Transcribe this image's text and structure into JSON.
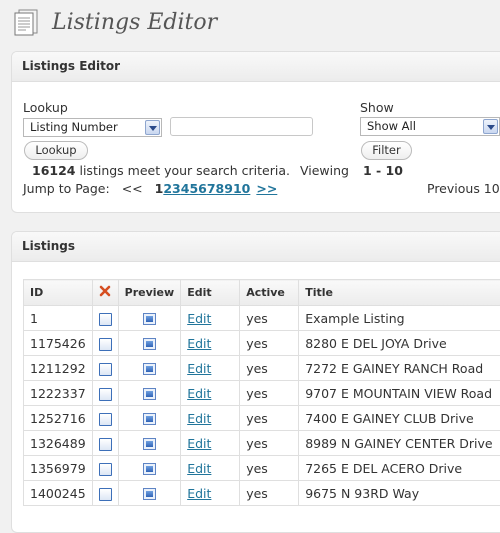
{
  "page": {
    "title": "Listings Editor",
    "icon": "document-icon"
  },
  "filter_box": {
    "heading": "Listings Editor",
    "lookup": {
      "label": "Lookup",
      "select_value": "Listing Number",
      "input_value": "",
      "button_label": "Lookup"
    },
    "show": {
      "label": "Show",
      "select_value": "Show All",
      "button_label": "Filter"
    },
    "results": {
      "count": "16124",
      "text": "listings meet your search criteria.",
      "viewing_label": "Viewing",
      "viewing_range": "1 - 10"
    },
    "pager": {
      "label": "Jump to Page:",
      "prev_arrows": "<<",
      "current": "1",
      "pages": [
        "2",
        "3",
        "4",
        "5",
        "6",
        "7",
        "8",
        "9",
        "10"
      ],
      "next_arrows": ">>",
      "previous_label": "Previous 10"
    }
  },
  "listings": {
    "heading": "Listings",
    "columns": {
      "id": "ID",
      "delete_icon": "delete-x-icon",
      "preview": "Preview",
      "edit": "Edit",
      "active": "Active",
      "title": "Title"
    },
    "edit_label": "Edit",
    "rows": [
      {
        "id": "1",
        "active": "yes",
        "title": "Example Listing"
      },
      {
        "id": "1175426",
        "active": "yes",
        "title": "8280 E DEL JOYA Drive"
      },
      {
        "id": "1211292",
        "active": "yes",
        "title": "7272 E GAINEY RANCH Road"
      },
      {
        "id": "1222337",
        "active": "yes",
        "title": "9707 E MOUNTAIN VIEW Road"
      },
      {
        "id": "1252716",
        "active": "yes",
        "title": "7400 E GAINEY CLUB Drive"
      },
      {
        "id": "1326489",
        "active": "yes",
        "title": "8989 N GAINEY CENTER Drive"
      },
      {
        "id": "1356979",
        "active": "yes",
        "title": "7265 E DEL ACERO Drive"
      },
      {
        "id": "1400245",
        "active": "yes",
        "title": "9675 N 93RD Way"
      }
    ]
  },
  "colors": {
    "link": "#21759b",
    "delete": "#d54e21"
  }
}
